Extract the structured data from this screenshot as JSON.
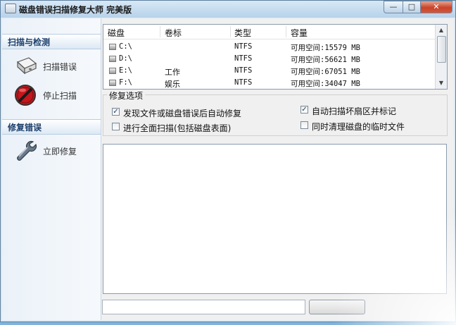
{
  "window": {
    "title": "磁盘错误扫描修复大师 完美版",
    "min_glyph": "—",
    "max_glyph": "□",
    "close_glyph": "✕"
  },
  "sidebar": {
    "scan_section": "扫描与检测",
    "scan_items": [
      {
        "label": "扫描错误",
        "icon": "disk-drive-icon"
      },
      {
        "label": "停止扫描",
        "icon": "stop-icon"
      }
    ],
    "repair_section": "修复错误",
    "repair_items": [
      {
        "label": "立即修复",
        "icon": "wrench-icon"
      }
    ]
  },
  "drive_list": {
    "columns": [
      "磁盘",
      "卷标",
      "类型",
      "容量"
    ],
    "rows": [
      {
        "disk": "C:\\",
        "label": "",
        "type": "NTFS",
        "capacity": "可用空间:15579 MB"
      },
      {
        "disk": "D:\\",
        "label": "",
        "type": "NTFS",
        "capacity": "可用空间:56621 MB"
      },
      {
        "disk": "E:\\",
        "label": "工作",
        "type": "NTFS",
        "capacity": "可用空间:67051 MB"
      },
      {
        "disk": "F:\\",
        "label": "娱乐",
        "type": "NTFS",
        "capacity": "可用空间:34047 MB"
      }
    ]
  },
  "options": {
    "title": "修复选项",
    "items": [
      {
        "label": "发现文件或磁盘错误后自动修复",
        "checked": true
      },
      {
        "label": "自动扫描坏扇区并标记",
        "checked": true
      },
      {
        "label": "进行全面扫描(包括磁盘表面)",
        "checked": false
      },
      {
        "label": "同时清理磁盘的临时文件",
        "checked": false
      }
    ]
  },
  "check_glyph": "✓"
}
